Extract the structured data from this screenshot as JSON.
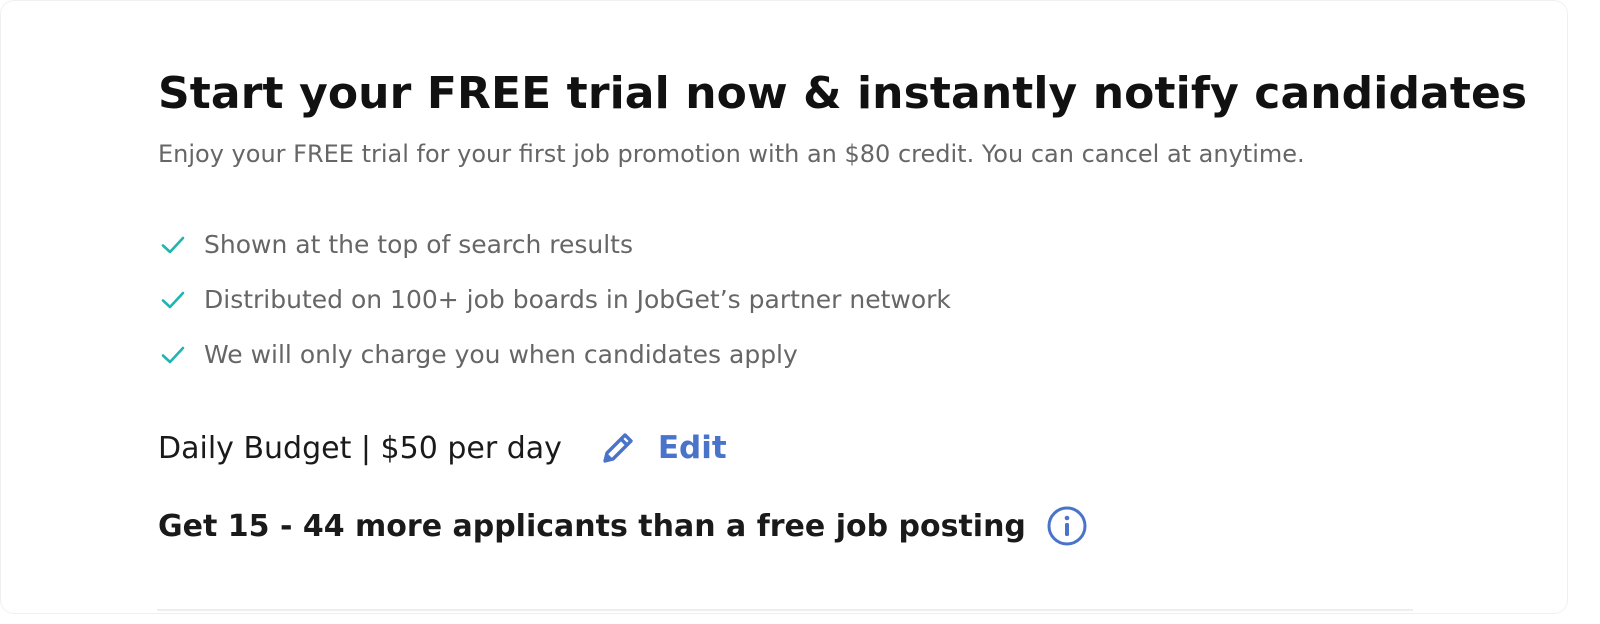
{
  "title": "Start your FREE trial now & instantly notify candidates",
  "subtitle": "Enjoy your FREE trial for your first job promotion with an $80 credit. You can cancel at anytime.",
  "features": [
    "Shown at the top of search results",
    "Distributed on 100+ job boards in JobGet’s partner network",
    "We will only charge you when candidates apply"
  ],
  "budget": {
    "text": "Daily Budget | $50 per day",
    "edit_label": "Edit"
  },
  "applicants": {
    "text": "Get 15 - 44 more applicants than a free job posting"
  },
  "icons": {
    "feature_check": "check-icon",
    "edit": "pencil-icon",
    "info": "info-icon"
  },
  "colors": {
    "check": "#1fb5b0",
    "accent": "#4a74c9",
    "title": "#111111",
    "muted": "#666666"
  }
}
